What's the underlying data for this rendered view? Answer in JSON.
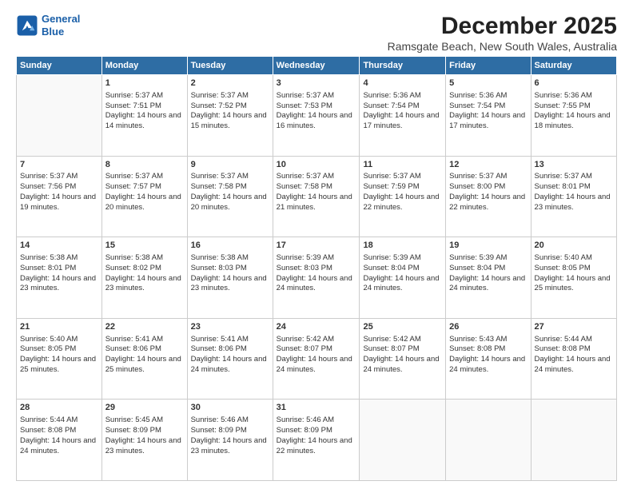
{
  "logo": {
    "line1": "General",
    "line2": "Blue"
  },
  "title": "December 2025",
  "subtitle": "Ramsgate Beach, New South Wales, Australia",
  "days_header": [
    "Sunday",
    "Monday",
    "Tuesday",
    "Wednesday",
    "Thursday",
    "Friday",
    "Saturday"
  ],
  "weeks": [
    [
      {
        "num": "",
        "empty": true
      },
      {
        "num": "1",
        "sunrise": "Sunrise: 5:37 AM",
        "sunset": "Sunset: 7:51 PM",
        "daylight": "Daylight: 14 hours and 14 minutes."
      },
      {
        "num": "2",
        "sunrise": "Sunrise: 5:37 AM",
        "sunset": "Sunset: 7:52 PM",
        "daylight": "Daylight: 14 hours and 15 minutes."
      },
      {
        "num": "3",
        "sunrise": "Sunrise: 5:37 AM",
        "sunset": "Sunset: 7:53 PM",
        "daylight": "Daylight: 14 hours and 16 minutes."
      },
      {
        "num": "4",
        "sunrise": "Sunrise: 5:36 AM",
        "sunset": "Sunset: 7:54 PM",
        "daylight": "Daylight: 14 hours and 17 minutes."
      },
      {
        "num": "5",
        "sunrise": "Sunrise: 5:36 AM",
        "sunset": "Sunset: 7:54 PM",
        "daylight": "Daylight: 14 hours and 17 minutes."
      },
      {
        "num": "6",
        "sunrise": "Sunrise: 5:36 AM",
        "sunset": "Sunset: 7:55 PM",
        "daylight": "Daylight: 14 hours and 18 minutes."
      }
    ],
    [
      {
        "num": "7",
        "sunrise": "Sunrise: 5:37 AM",
        "sunset": "Sunset: 7:56 PM",
        "daylight": "Daylight: 14 hours and 19 minutes."
      },
      {
        "num": "8",
        "sunrise": "Sunrise: 5:37 AM",
        "sunset": "Sunset: 7:57 PM",
        "daylight": "Daylight: 14 hours and 20 minutes."
      },
      {
        "num": "9",
        "sunrise": "Sunrise: 5:37 AM",
        "sunset": "Sunset: 7:58 PM",
        "daylight": "Daylight: 14 hours and 20 minutes."
      },
      {
        "num": "10",
        "sunrise": "Sunrise: 5:37 AM",
        "sunset": "Sunset: 7:58 PM",
        "daylight": "Daylight: 14 hours and 21 minutes."
      },
      {
        "num": "11",
        "sunrise": "Sunrise: 5:37 AM",
        "sunset": "Sunset: 7:59 PM",
        "daylight": "Daylight: 14 hours and 22 minutes."
      },
      {
        "num": "12",
        "sunrise": "Sunrise: 5:37 AM",
        "sunset": "Sunset: 8:00 PM",
        "daylight": "Daylight: 14 hours and 22 minutes."
      },
      {
        "num": "13",
        "sunrise": "Sunrise: 5:37 AM",
        "sunset": "Sunset: 8:01 PM",
        "daylight": "Daylight: 14 hours and 23 minutes."
      }
    ],
    [
      {
        "num": "14",
        "sunrise": "Sunrise: 5:38 AM",
        "sunset": "Sunset: 8:01 PM",
        "daylight": "Daylight: 14 hours and 23 minutes."
      },
      {
        "num": "15",
        "sunrise": "Sunrise: 5:38 AM",
        "sunset": "Sunset: 8:02 PM",
        "daylight": "Daylight: 14 hours and 23 minutes."
      },
      {
        "num": "16",
        "sunrise": "Sunrise: 5:38 AM",
        "sunset": "Sunset: 8:03 PM",
        "daylight": "Daylight: 14 hours and 23 minutes."
      },
      {
        "num": "17",
        "sunrise": "Sunrise: 5:39 AM",
        "sunset": "Sunset: 8:03 PM",
        "daylight": "Daylight: 14 hours and 24 minutes."
      },
      {
        "num": "18",
        "sunrise": "Sunrise: 5:39 AM",
        "sunset": "Sunset: 8:04 PM",
        "daylight": "Daylight: 14 hours and 24 minutes."
      },
      {
        "num": "19",
        "sunrise": "Sunrise: 5:39 AM",
        "sunset": "Sunset: 8:04 PM",
        "daylight": "Daylight: 14 hours and 24 minutes."
      },
      {
        "num": "20",
        "sunrise": "Sunrise: 5:40 AM",
        "sunset": "Sunset: 8:05 PM",
        "daylight": "Daylight: 14 hours and 25 minutes."
      }
    ],
    [
      {
        "num": "21",
        "sunrise": "Sunrise: 5:40 AM",
        "sunset": "Sunset: 8:05 PM",
        "daylight": "Daylight: 14 hours and 25 minutes."
      },
      {
        "num": "22",
        "sunrise": "Sunrise: 5:41 AM",
        "sunset": "Sunset: 8:06 PM",
        "daylight": "Daylight: 14 hours and 25 minutes."
      },
      {
        "num": "23",
        "sunrise": "Sunrise: 5:41 AM",
        "sunset": "Sunset: 8:06 PM",
        "daylight": "Daylight: 14 hours and 24 minutes."
      },
      {
        "num": "24",
        "sunrise": "Sunrise: 5:42 AM",
        "sunset": "Sunset: 8:07 PM",
        "daylight": "Daylight: 14 hours and 24 minutes."
      },
      {
        "num": "25",
        "sunrise": "Sunrise: 5:42 AM",
        "sunset": "Sunset: 8:07 PM",
        "daylight": "Daylight: 14 hours and 24 minutes."
      },
      {
        "num": "26",
        "sunrise": "Sunrise: 5:43 AM",
        "sunset": "Sunset: 8:08 PM",
        "daylight": "Daylight: 14 hours and 24 minutes."
      },
      {
        "num": "27",
        "sunrise": "Sunrise: 5:44 AM",
        "sunset": "Sunset: 8:08 PM",
        "daylight": "Daylight: 14 hours and 24 minutes."
      }
    ],
    [
      {
        "num": "28",
        "sunrise": "Sunrise: 5:44 AM",
        "sunset": "Sunset: 8:08 PM",
        "daylight": "Daylight: 14 hours and 24 minutes."
      },
      {
        "num": "29",
        "sunrise": "Sunrise: 5:45 AM",
        "sunset": "Sunset: 8:09 PM",
        "daylight": "Daylight: 14 hours and 23 minutes."
      },
      {
        "num": "30",
        "sunrise": "Sunrise: 5:46 AM",
        "sunset": "Sunset: 8:09 PM",
        "daylight": "Daylight: 14 hours and 23 minutes."
      },
      {
        "num": "31",
        "sunrise": "Sunrise: 5:46 AM",
        "sunset": "Sunset: 8:09 PM",
        "daylight": "Daylight: 14 hours and 22 minutes."
      },
      {
        "num": "",
        "empty": true
      },
      {
        "num": "",
        "empty": true
      },
      {
        "num": "",
        "empty": true
      }
    ]
  ]
}
